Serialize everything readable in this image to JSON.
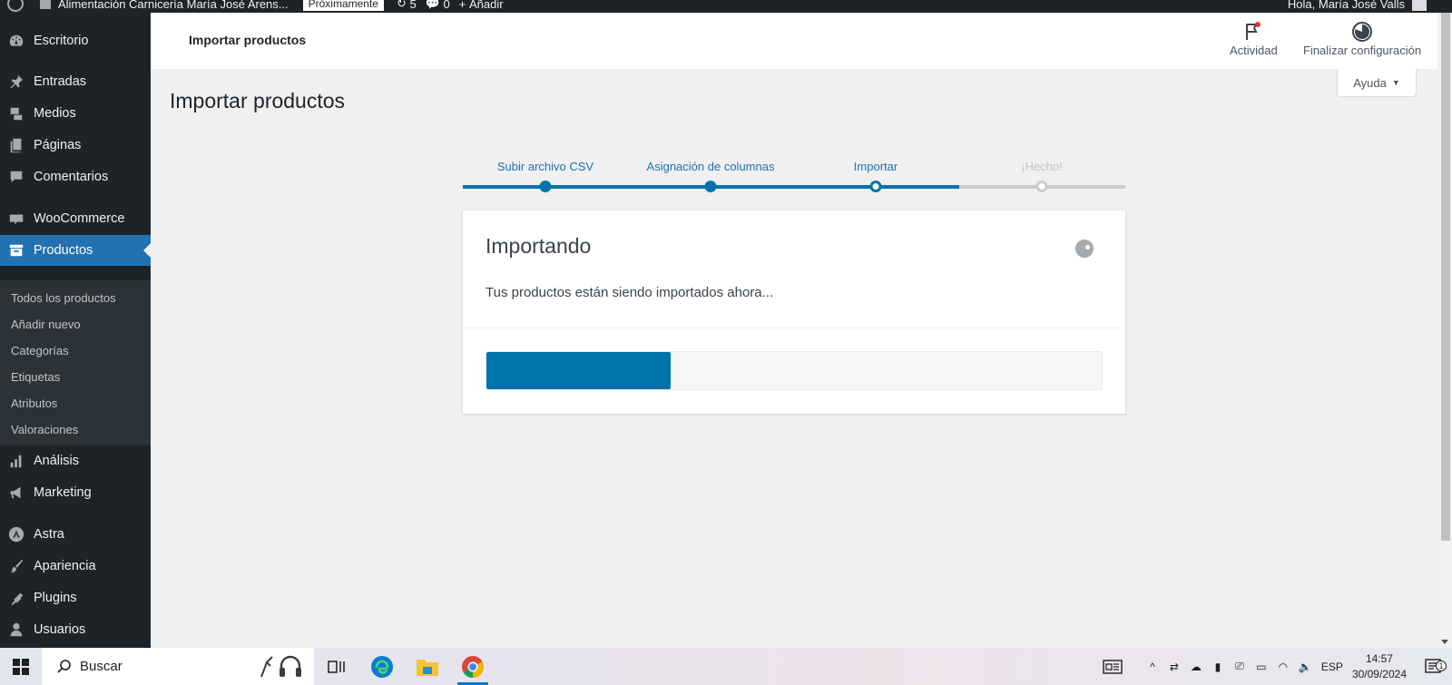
{
  "admin_bar": {
    "site_name": "Alimentación Carnicería María José Arens...",
    "badge": "Próximamente",
    "updates": "5",
    "comments": "0",
    "add_new": "Añadir",
    "greeting": "Hola, María José Valls"
  },
  "sidebar": {
    "items": [
      {
        "label": "Escritorio",
        "icon": "dashboard-icon"
      },
      {
        "label": "Entradas",
        "icon": "pin-icon"
      },
      {
        "label": "Medios",
        "icon": "media-icon"
      },
      {
        "label": "Páginas",
        "icon": "pages-icon"
      },
      {
        "label": "Comentarios",
        "icon": "comments-icon"
      },
      {
        "label": "WooCommerce",
        "icon": "woocommerce-icon"
      },
      {
        "label": "Productos",
        "icon": "archive-icon"
      },
      {
        "label": "Análisis",
        "icon": "chart-bar-icon"
      },
      {
        "label": "Marketing",
        "icon": "megaphone-icon"
      },
      {
        "label": "Astra",
        "icon": "astra-icon"
      },
      {
        "label": "Apariencia",
        "icon": "brush-icon"
      },
      {
        "label": "Plugins",
        "icon": "plugin-icon"
      },
      {
        "label": "Usuarios",
        "icon": "user-icon"
      }
    ],
    "submenu": [
      "Todos los productos",
      "Añadir nuevo",
      "Categorías",
      "Etiquetas",
      "Atributos",
      "Valoraciones"
    ]
  },
  "header": {
    "title": "Importar productos",
    "activity_label": "Actividad",
    "finish_setup_label": "Finalizar configuración"
  },
  "help_tab": {
    "label": "Ayuda"
  },
  "page_title": "Importar productos",
  "stepper": {
    "steps": [
      {
        "label": "Subir archivo CSV",
        "state": "done"
      },
      {
        "label": "Asignación de columnas",
        "state": "done"
      },
      {
        "label": "Importar",
        "state": "current"
      },
      {
        "label": "¡Hecho!",
        "state": "future"
      }
    ]
  },
  "card": {
    "title": "Importando",
    "description": "Tus productos están siendo importados ahora...",
    "progress_fraction": 0.3
  },
  "taskbar": {
    "search_placeholder": "Buscar",
    "language": "ESP",
    "time": "14:57",
    "date": "30/09/2024",
    "notifications": "1"
  },
  "colors": {
    "accent": "#2271b1",
    "progress": "#0073aa",
    "sidebar_bg": "#1d2327",
    "submenu_bg": "#2c3338"
  }
}
